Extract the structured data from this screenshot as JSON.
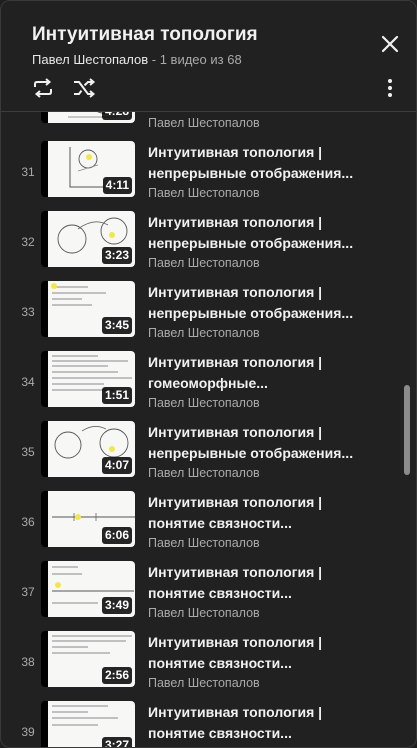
{
  "playlist": {
    "title": "Интуитивная топология",
    "author": "Павел Шестопалов",
    "progress": " - 1 видео из 68",
    "icons": {
      "close": "close-icon",
      "loop": "loop-icon",
      "shuffle": "shuffle-icon",
      "more": "more-vert-icon"
    }
  },
  "items": [
    {
      "index": "",
      "title_line1": "",
      "title_line2": "",
      "duration": "4:28",
      "channel": "Павел Шестопалов"
    },
    {
      "index": "31",
      "title_line1": "Интуитивная топология |",
      "title_line2": "непрерывные отображения...",
      "duration": "4:11",
      "channel": "Павел Шестопалов"
    },
    {
      "index": "32",
      "title_line1": "Интуитивная топология |",
      "title_line2": "непрерывные отображения...",
      "duration": "3:23",
      "channel": "Павел Шестопалов"
    },
    {
      "index": "33",
      "title_line1": "Интуитивная топология |",
      "title_line2": "непрерывные отображения...",
      "duration": "3:45",
      "channel": "Павел Шестопалов"
    },
    {
      "index": "34",
      "title_line1": "Интуитивная топология |",
      "title_line2": "гомеоморфные...",
      "duration": "1:51",
      "channel": "Павел Шестопалов"
    },
    {
      "index": "35",
      "title_line1": "Интуитивная топология |",
      "title_line2": "непрерывные отображения...",
      "duration": "4:07",
      "channel": "Павел Шестопалов"
    },
    {
      "index": "36",
      "title_line1": "Интуитивная топология |",
      "title_line2": "понятие связности...",
      "duration": "6:06",
      "channel": "Павел Шестопалов"
    },
    {
      "index": "37",
      "title_line1": "Интуитивная топология |",
      "title_line2": "понятие связности...",
      "duration": "3:49",
      "channel": "Павел Шестопалов"
    },
    {
      "index": "38",
      "title_line1": "Интуитивная топология |",
      "title_line2": "понятие связности...",
      "duration": "2:56",
      "channel": "Павел Шестопалов"
    },
    {
      "index": "39",
      "title_line1": "Интуитивная топология |",
      "title_line2": "понятие связности...",
      "duration": "3:27",
      "channel": ""
    }
  ]
}
